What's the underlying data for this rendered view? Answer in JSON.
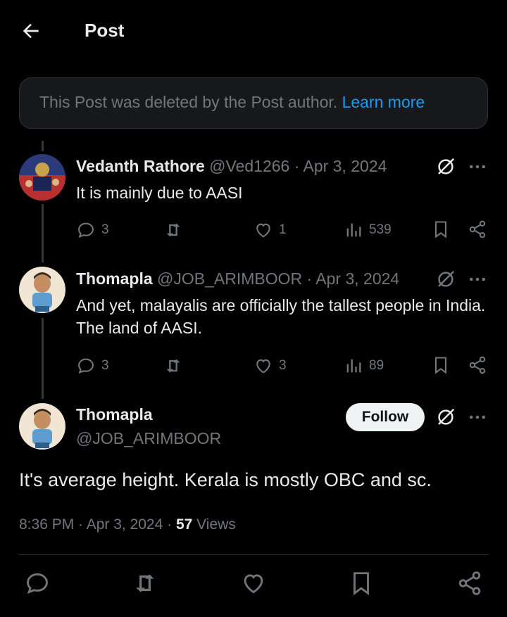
{
  "header": {
    "title": "Post"
  },
  "deleted_notice": {
    "text": "This Post was deleted by the Post author.",
    "link": "Learn more"
  },
  "replies": [
    {
      "name": "Vedanth Rathore",
      "handle": "@Ved1266",
      "date": "· Apr 3, 2024",
      "text": "It is mainly due to AASI",
      "replies": "3",
      "reposts": "",
      "likes": "1",
      "views": "539"
    },
    {
      "name": "Thomapla",
      "handle": "@JOB_ARIMBOOR",
      "date": "· Apr 3, 2024",
      "text": "And yet, malayalis are officially the tallest people in India. The land of AASI.",
      "replies": "3",
      "reposts": "",
      "likes": "3",
      "views": "89"
    }
  ],
  "main_post": {
    "name": "Thomapla",
    "handle": "@JOB_ARIMBOOR",
    "follow_label": "Follow",
    "text": "It's average height. Kerala is mostly OBC and sc.",
    "time": "8:36 PM · Apr 3, 2024 · ",
    "views_count": "57",
    "views_label": " Views"
  },
  "colors": {
    "accent": "#1d9bf0",
    "muted": "#71767b",
    "text": "#e7e9ea",
    "bg": "#000000"
  },
  "icons": [
    "arrow-left-icon",
    "grok-icon",
    "more-icon",
    "reply-icon",
    "repost-icon",
    "like-icon",
    "views-icon",
    "bookmark-icon",
    "share-icon"
  ]
}
